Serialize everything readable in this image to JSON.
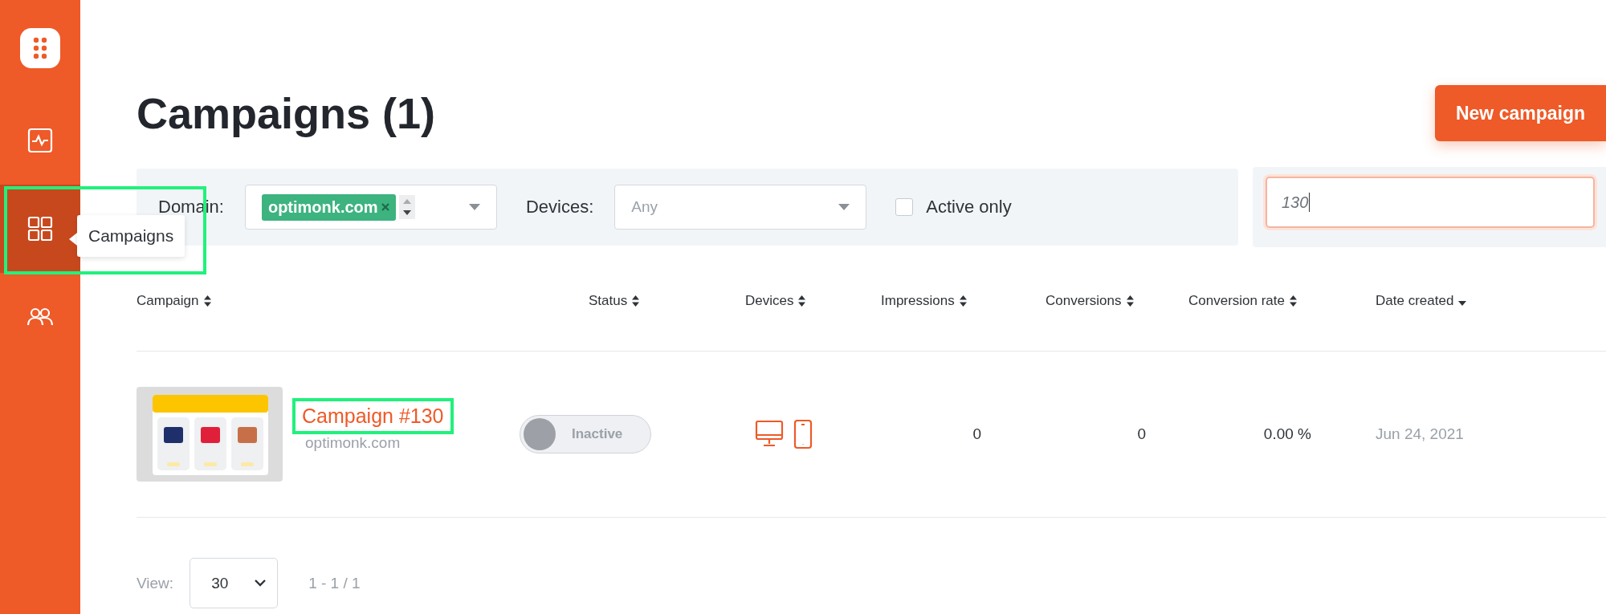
{
  "sidebar": {
    "items": [
      {
        "kind": "analytics",
        "selected": false
      },
      {
        "kind": "campaigns",
        "selected": true,
        "highlighted": true,
        "tooltip": "Campaigns"
      },
      {
        "kind": "users",
        "selected": false
      }
    ]
  },
  "header": {
    "title": "Campaigns (1)",
    "button": "New campaign"
  },
  "filters": {
    "domain_label": "Domain:",
    "domain_tags": [
      "optimonk.com"
    ],
    "devices_label": "Devices:",
    "devices_placeholder": "Any",
    "active_only": {
      "label": "Active only",
      "checked": false
    },
    "search_value": "130"
  },
  "table": {
    "columns": [
      {
        "label": "Campaign",
        "sorted": false
      },
      {
        "label": "Status",
        "sorted": false
      },
      {
        "label": "Devices",
        "sorted": false
      },
      {
        "label": "Impressions",
        "sorted": false
      },
      {
        "label": "Conversions",
        "sorted": false
      },
      {
        "label": "Conversion rate",
        "sorted": false
      },
      {
        "label": "Date created",
        "sorted": true
      }
    ],
    "rows": [
      {
        "thumbnail": {
          "kind": "picture"
        },
        "name": "Campaign #130",
        "highlighted": true,
        "domain": "optimonk.com",
        "status": {
          "label": "Inactive",
          "on": false
        },
        "devices": [
          {
            "kind": "desktop"
          },
          {
            "kind": "mobile"
          }
        ],
        "impressions": "0",
        "conversions": "0",
        "conversion_rate": "0.00 %",
        "date_created": "Jun 24, 2021"
      }
    ]
  },
  "footer": {
    "view_label": "View:",
    "page_size": "30",
    "range": "1 - 1 / 1"
  }
}
